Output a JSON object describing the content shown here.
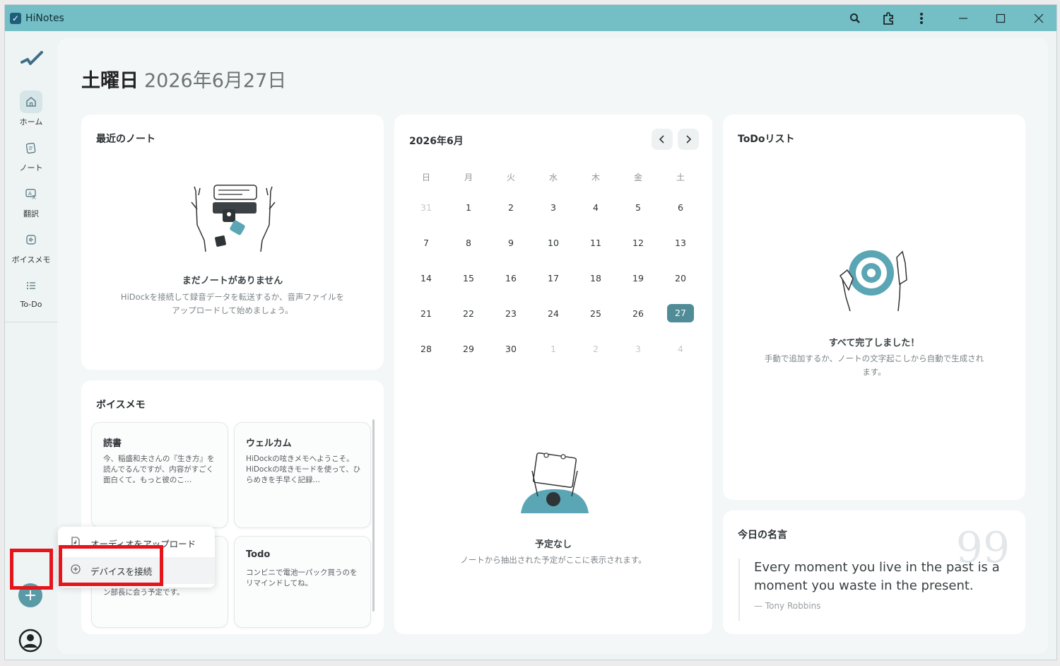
{
  "app": {
    "title": "HiNotes"
  },
  "sidebar": {
    "items": [
      {
        "label": "ホーム",
        "icon": "home-icon"
      },
      {
        "label": "ノート",
        "icon": "note-icon"
      },
      {
        "label": "翻訳",
        "icon": "translate-icon"
      },
      {
        "label": "ボイスメモ",
        "icon": "voice-memo-icon"
      },
      {
        "label": "To-Do",
        "icon": "todo-icon"
      }
    ],
    "add_button": "+"
  },
  "header": {
    "day": "土曜日",
    "date": "2026年6月27日"
  },
  "recent_notes": {
    "title": "最近のノート",
    "empty_title": "まだノートがありません",
    "empty_desc_1": "HiDockを接続して録音データを転送するか、音声ファイルを",
    "empty_desc_2": "アップロードして始めましょう。"
  },
  "calendar": {
    "title": "2026年6月",
    "weekdays": [
      "日",
      "月",
      "火",
      "水",
      "木",
      "金",
      "土"
    ],
    "weeks": [
      [
        "31",
        "1",
        "2",
        "3",
        "4",
        "5",
        "6"
      ],
      [
        "7",
        "8",
        "9",
        "10",
        "11",
        "12",
        "13"
      ],
      [
        "14",
        "15",
        "16",
        "17",
        "18",
        "19",
        "20"
      ],
      [
        "21",
        "22",
        "23",
        "24",
        "25",
        "26",
        "27"
      ],
      [
        "28",
        "29",
        "30",
        "1",
        "2",
        "3",
        "4"
      ]
    ],
    "today": "27",
    "empty_title": "予定なし",
    "empty_desc": "ノートから抽出された予定がここに表示されます。"
  },
  "todo": {
    "title": "ToDoリスト",
    "empty_title": "すべて完了しました！",
    "empty_desc_1": "手動で追加するか、ノートの文字起こしから自動で生成され",
    "empty_desc_2": "ます。"
  },
  "voice_memos": {
    "title": "ボイスメモ",
    "cards": [
      {
        "title": "読書",
        "body": "今、稲盛和夫さんの『生き方』を読んでるんですが、内容がすごく面白くて。もっと彼のこ…"
      },
      {
        "title": "ウェルカム",
        "body": "HiDockの呟きメモへようこそ。HiDockの呟きモードを使って、ひらめきを手早く記録…"
      },
      {
        "title": "",
        "body": "ン部長に会う予定です。"
      },
      {
        "title": "Todo",
        "body": "コンビニで電池一パック買うのをリマインドしてね。"
      }
    ]
  },
  "popup": {
    "upload": "オーディオをアップロード",
    "connect": "デバイスを接続"
  },
  "quote": {
    "title": "今日の名言",
    "text": "Every moment you live in the past is a moment you waste in the present.",
    "author": "— Tony Robbins"
  },
  "colors": {
    "titlebar": "#74bec6",
    "accent": "#4f8c98",
    "highlight": "#e4151b"
  }
}
